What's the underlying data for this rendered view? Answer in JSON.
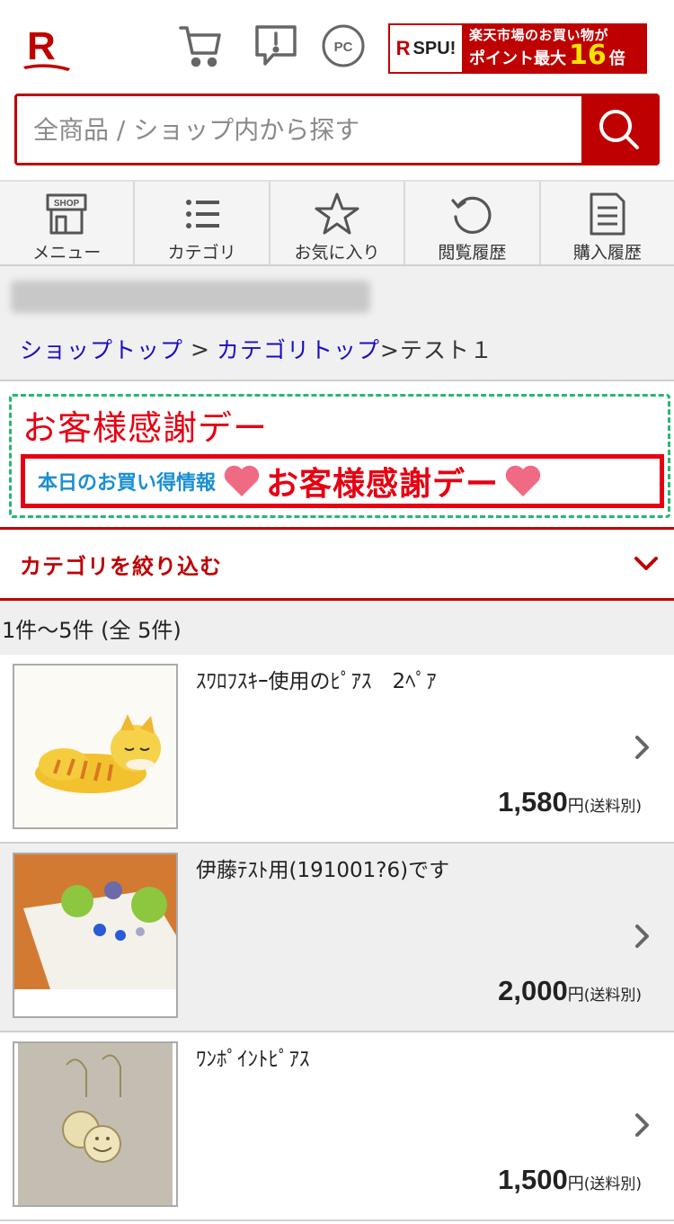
{
  "header": {
    "logo_letter": "R",
    "icons": [
      "cart-icon",
      "inquiry-icon",
      "pc-icon"
    ],
    "pc_label": "PC",
    "spu": {
      "r": "R",
      "label": "SPU!",
      "line1": "楽天市場のお買い物が",
      "line2_pre": "ポイント最大",
      "line2_num": "16",
      "line2_post": "倍"
    }
  },
  "search": {
    "placeholder": "全商品 / ショップ内から探す",
    "value": ""
  },
  "nav": [
    {
      "label": "メニュー",
      "icon": "shop-icon",
      "icon_text": "SHOP"
    },
    {
      "label": "カテゴリ",
      "icon": "list-icon"
    },
    {
      "label": "お気に入り",
      "icon": "star-icon"
    },
    {
      "label": "閲覧履歴",
      "icon": "history-icon"
    },
    {
      "label": "購入履歴",
      "icon": "receipt-icon"
    }
  ],
  "breadcrumb": {
    "shop_top": "ショップトップ",
    "sep": ">",
    "category_top": "カテゴリトップ",
    "current": ">テスト１"
  },
  "banner": {
    "title": "お客様感謝デー",
    "image_small": "本日のお買い得情報",
    "image_big": "お客様感謝デー"
  },
  "filter": {
    "label": "カテゴリを絞り込む"
  },
  "result_count": "1件〜5件 (全 5件)",
  "colors": {
    "brand": "#bf0000",
    "link": "#1a0dbf",
    "banner_red": "#e60012",
    "banner_blue": "#1a8fd1",
    "dashed_green": "#27b873"
  },
  "products": [
    {
      "name": "ｽﾜﾛﾌｽｷｰ使用のﾋﾟｱｽ　2ﾍﾟｱ",
      "price": "1,580",
      "yen": "円",
      "shipping": "(送料別)"
    },
    {
      "name": "伊藤ﾃｽﾄ用(191001?6)です",
      "price": "2,000",
      "yen": "円",
      "shipping": "(送料別)"
    },
    {
      "name": "ﾜﾝﾎﾟｲﾝﾄﾋﾟｱｽ",
      "price": "1,500",
      "yen": "円",
      "shipping": "(送料別)"
    }
  ]
}
